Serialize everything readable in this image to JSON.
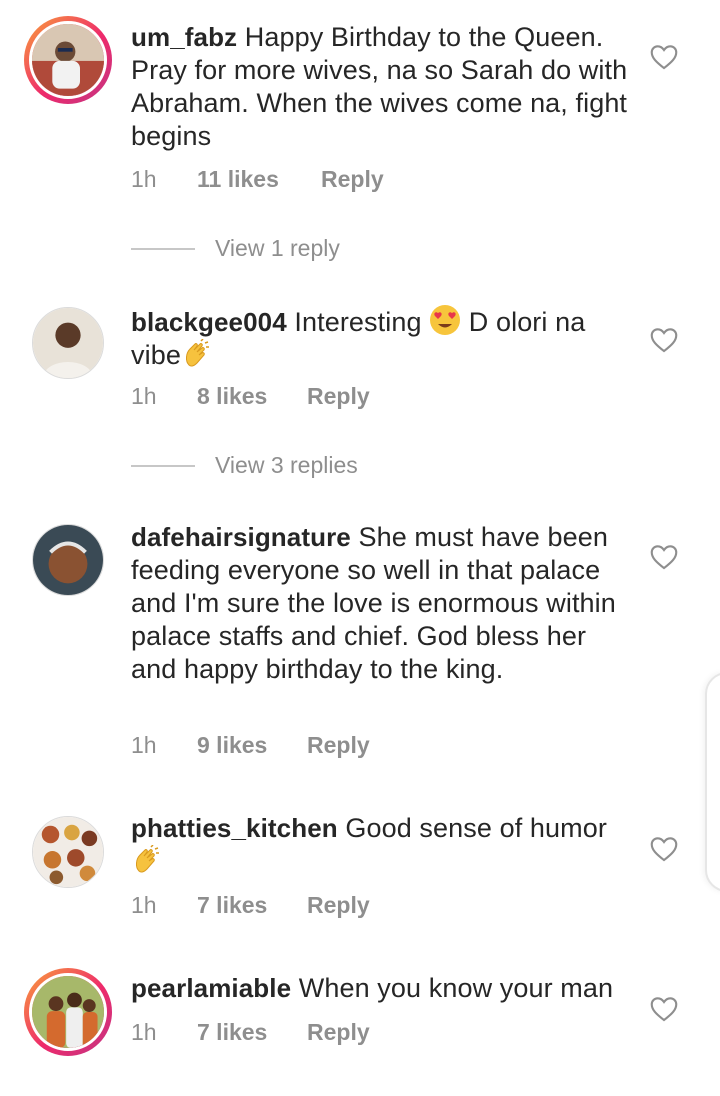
{
  "comments": [
    {
      "username": "um_fabz",
      "text": " Happy Birthday to the Queen. Pray for more wives, na so Sarah do with Abraham. When the wives come na, fight begins",
      "time": "1h",
      "likes": "11 likes",
      "reply": "Reply",
      "view_replies": "View 1 reply",
      "story_ring": true
    },
    {
      "username": "blackgee004",
      "text_a": " Interesting ",
      "text_b": " D olori na vibe",
      "emoji_a": "heart-eyes-emoji",
      "emoji_b": "clapping-hands-emoji",
      "time": "1h",
      "likes": "8 likes",
      "reply": "Reply",
      "view_replies": "View 3 replies",
      "story_ring": false
    },
    {
      "username": "dafehairsignature",
      "text": " She must have been feeding everyone so well in that palace and I'm sure the love is enormous within palace staffs and chief. God bless her and happy birthday to the king.",
      "time": "1h",
      "likes": "9 likes",
      "reply": "Reply",
      "story_ring": false
    },
    {
      "username": "phatties_kitchen",
      "text": " Good sense of humor",
      "emoji": "clapping-hands-emoji",
      "time": "1h",
      "likes": "7 likes",
      "reply": "Reply",
      "story_ring": false
    },
    {
      "username": "pearlamiable",
      "text": " When you know your man",
      "time": "1h",
      "likes": "7 likes",
      "reply": "Reply",
      "story_ring": true
    }
  ],
  "colors": {
    "text": "#262626",
    "secondary": "#8e8e8e",
    "ring_start": "#f9a23a",
    "ring_end": "#c13584"
  }
}
